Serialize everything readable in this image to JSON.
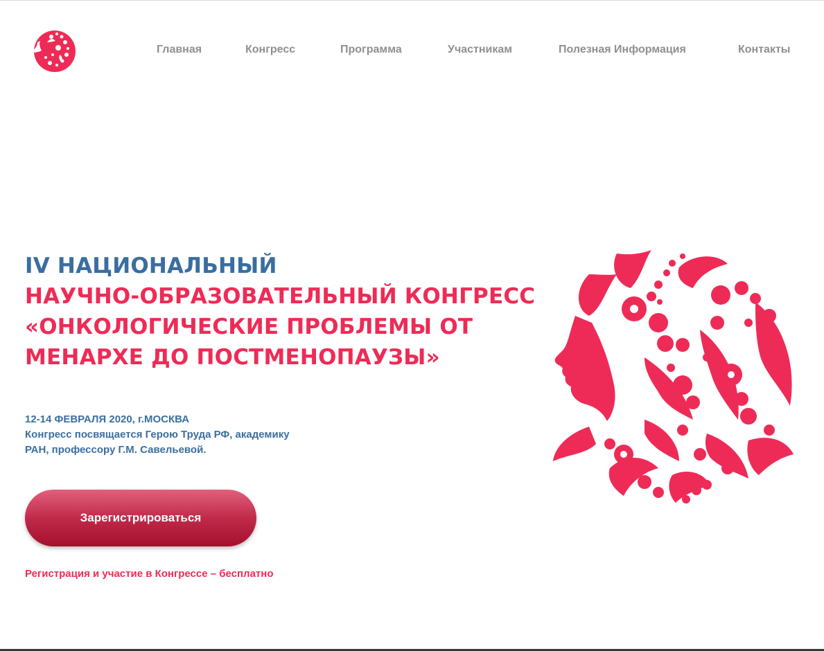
{
  "brand": {
    "logo_icon": "woman-profile-floral-logo-icon",
    "accent_color": "#ee2b56",
    "secondary_color": "#3a6ea0"
  },
  "nav": {
    "items": [
      {
        "label": "Главная"
      },
      {
        "label": "Конгресс"
      },
      {
        "label": "Программа"
      },
      {
        "label": "Участникам"
      },
      {
        "label": "Полезная Информация"
      },
      {
        "label": "Контакты"
      }
    ]
  },
  "hero": {
    "title_line1": "IV НАЦИОНАЛЬНЫЙ",
    "title_line2": "НАУЧНО-ОБРАЗОВАТЕЛЬНЫЙ КОНГРЕСС",
    "title_line3": "«ОНКОЛОГИЧЕСКИЕ ПРОБЛЕМЫ ОТ",
    "title_line4": "МЕНАРХЕ ДО ПОСТМЕНОПАУЗЫ»",
    "date_place": "12-14 ФЕВРАЛЯ 2020, г.МОСКВА",
    "dedication_line1": "Конгресс посвящается Герою Труда РФ, академику",
    "dedication_line2": "РАН, профессору Г.М. Савельевой.",
    "register_button": "Зарегистрироваться",
    "free_note": "Регистрация и участие в Конгрессе – бесплатно",
    "art_icon": "woman-profile-floral-illustration-icon"
  }
}
